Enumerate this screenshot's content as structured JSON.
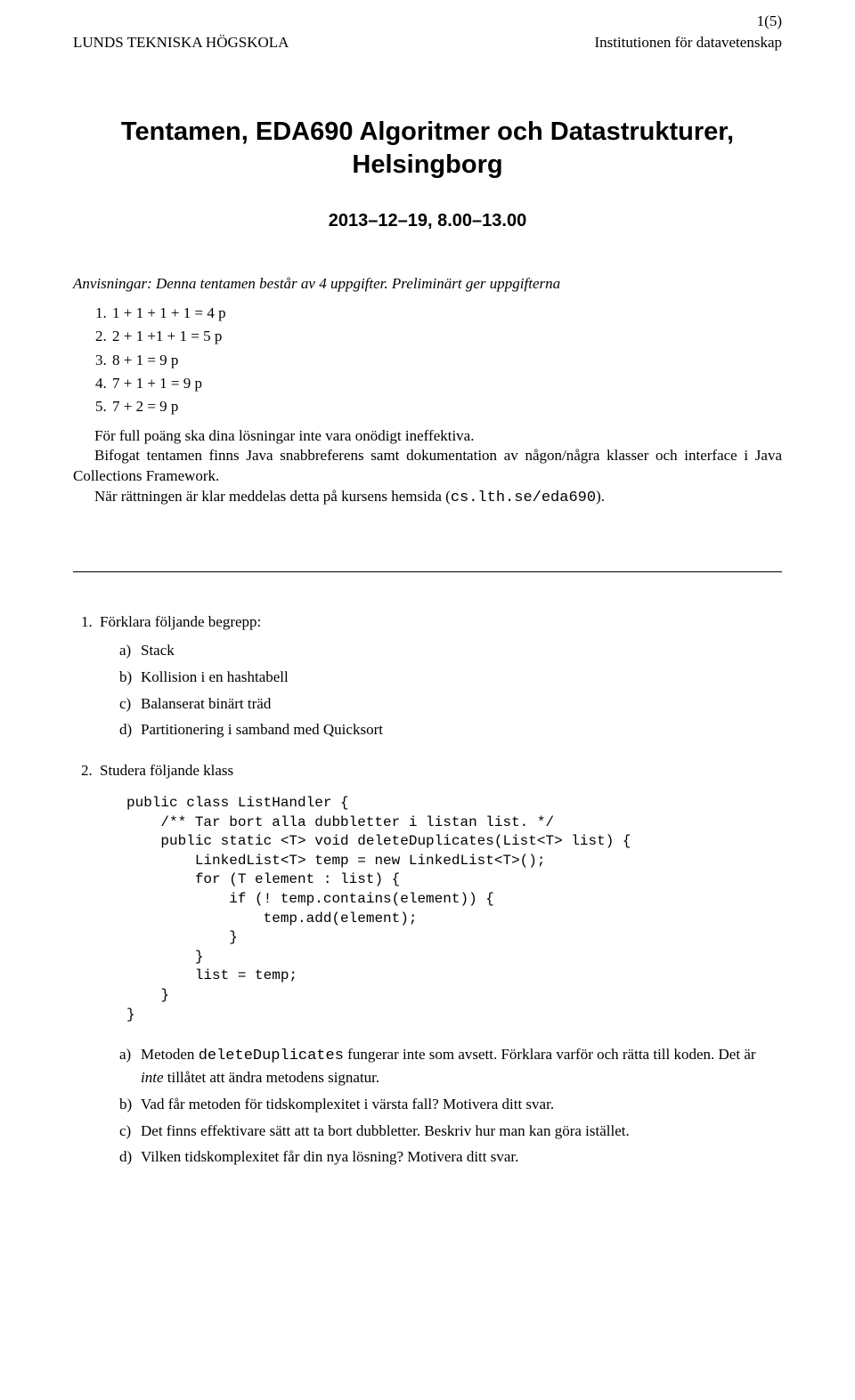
{
  "pagenum": "1(5)",
  "header": {
    "left": "LUNDS TEKNISKA HÖGSKOLA",
    "right": "Institutionen för datavetenskap"
  },
  "title_line1": "Tentamen, EDA690 Algoritmer och Datastrukturer,",
  "title_line2": "Helsingborg",
  "date": "2013–12–19, 8.00–13.00",
  "instr_prefix": "Anvisningar:",
  "instr_rest": " Denna tentamen består av 4 uppgifter. Preliminärt ger uppgifterna",
  "points": [
    "1 + 1 + 1 + 1 = 4 p",
    "2 + 1 +1 + 1 = 5 p",
    "8 + 1 = 9 p",
    "7 + 1 + 1 = 9 p",
    "7 + 2 = 9 p"
  ],
  "para1": "För full poäng ska dina lösningar inte vara onödigt ineffektiva.",
  "para2": "Bifogat tentamen finns Java snabbreferens samt dokumentation av någon/några klasser och interface i Java Collections Framework.",
  "para3_a": "När rättningen är klar meddelas detta på kursens hemsida (",
  "para3_code": "cs.lth.se/eda690",
  "para3_b": ").",
  "q1_intro": "Förklara följande begrepp:",
  "q1_items": {
    "a": "Stack",
    "b": "Kollision i en hashtabell",
    "c": "Balanserat binärt träd",
    "d": "Partitionering i samband med Quicksort"
  },
  "q2_intro": "Studera följande klass",
  "code": "public class ListHandler {\n    /** Tar bort alla dubbletter i listan list. */\n    public static <T> void deleteDuplicates(List<T> list) {\n        LinkedList<T> temp = new LinkedList<T>();\n        for (T element : list) {\n            if (! temp.contains(element)) {\n                temp.add(element);\n            }\n        }\n        list = temp;\n    }\n}",
  "q2_items": {
    "a_1": "Metoden ",
    "a_code": "deleteDuplicates",
    "a_2": " fungerar inte som avsett. Förklara varför och rätta till koden. Det är ",
    "a_em": "inte",
    "a_3": " tillåtet att ändra metodens signatur.",
    "b": "Vad får metoden för tidskomplexitet i värsta fall? Motivera ditt svar.",
    "c": "Det finns effektivare sätt att ta bort dubbletter. Beskriv hur man kan göra istället.",
    "d": "Vilken tidskomplexitet får din nya lösning? Motivera ditt svar."
  }
}
